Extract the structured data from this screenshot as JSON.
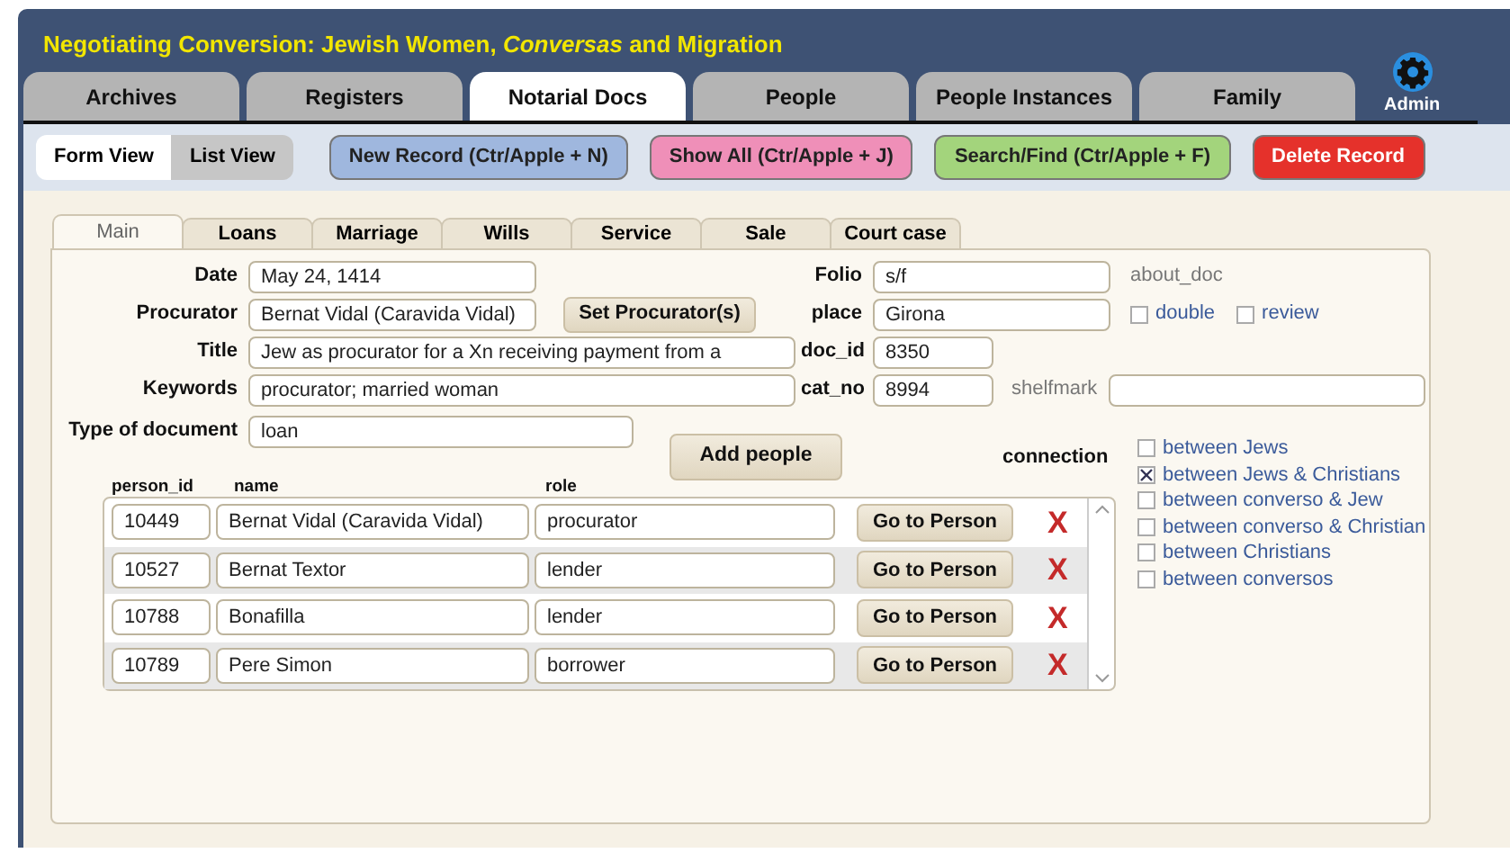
{
  "app": {
    "title": "Negotiating Conversion: Jewish Women, *Conversas* and Migration"
  },
  "tabs": [
    {
      "label": "Archives",
      "selected": false
    },
    {
      "label": "Registers",
      "selected": false
    },
    {
      "label": "Notarial Docs",
      "selected": true
    },
    {
      "label": "People",
      "selected": false
    },
    {
      "label": "People Instances",
      "selected": false
    },
    {
      "label": "Family",
      "selected": false
    }
  ],
  "admin": {
    "label": "Admin"
  },
  "view_toggle": [
    {
      "label": "Form View",
      "selected": true
    },
    {
      "label": "List View",
      "selected": false
    }
  ],
  "actions": [
    {
      "label": "New Record (Ctr/Apple + N)",
      "color": "#9fb7de"
    },
    {
      "label": "Show All (Ctr/Apple + J)",
      "color": "#ef8fb8"
    },
    {
      "label": "Search/Find (Ctr/Apple + F)",
      "color": "#a3d47c"
    },
    {
      "label": "Delete Record",
      "color": "#e5312b"
    }
  ],
  "record_tabs": [
    {
      "label": "Main",
      "selected": true
    },
    {
      "label": "Loans",
      "selected": false
    },
    {
      "label": "Marriage",
      "selected": false
    },
    {
      "label": "Wills",
      "selected": false
    },
    {
      "label": "Service",
      "selected": false
    },
    {
      "label": "Sale",
      "selected": false
    },
    {
      "label": "Court case",
      "selected": false
    }
  ],
  "date": {
    "label": "Date",
    "value": "May 24, 1414"
  },
  "procurator": {
    "label": "Procurator",
    "value": "Bernat Vidal (Caravida Vidal)",
    "button": "Set Procurator(s)"
  },
  "title": {
    "label": "Title",
    "value": "Jew as procurator for a Xn receiving payment from a"
  },
  "keywords": {
    "label": "Keywords",
    "value": "procurator; married woman"
  },
  "type_of_document": {
    "label": "Type of document",
    "value": "loan"
  },
  "folio": {
    "label": "Folio",
    "value": "s/f"
  },
  "about_doc": "about_doc",
  "place": {
    "label": "place",
    "value": "Girona"
  },
  "flags": [
    {
      "label": "double",
      "checked": false
    },
    {
      "label": "review",
      "checked": false
    }
  ],
  "doc_id": {
    "label": "doc_id",
    "value": "8350"
  },
  "cat_no": {
    "label": "cat_no",
    "value": "8994"
  },
  "shelfmark": {
    "label": "shelfmark"
  },
  "add_people_button": "Add people",
  "people": {
    "columns": [
      "person_id",
      "name",
      "role"
    ],
    "rows": [
      {
        "person_id": "10449",
        "name": "Bernat Vidal (Caravida Vidal)",
        "role": "procurator",
        "button": "Go to Person",
        "delete": "X"
      },
      {
        "person_id": "10527",
        "name": "Bernat Textor",
        "role": "lender",
        "button": "Go to Person",
        "delete": "X"
      },
      {
        "person_id": "10788",
        "name": "Bonafilla",
        "role": "lender",
        "button": "Go to Person",
        "delete": "X"
      },
      {
        "person_id": "10789",
        "name": "Pere Simon",
        "role": "borrower",
        "button": "Go to Person",
        "delete": "X"
      }
    ]
  },
  "connection": {
    "label": "connection",
    "options": [
      {
        "label": "between Jews",
        "checked": false
      },
      {
        "label": "between Jews & Christians",
        "checked": true
      },
      {
        "label": "between converso & Jew",
        "checked": false
      },
      {
        "label": "between converso & Christian",
        "checked": false
      },
      {
        "label": "between Christians",
        "checked": false
      },
      {
        "label": "between conversos",
        "checked": false
      }
    ]
  }
}
